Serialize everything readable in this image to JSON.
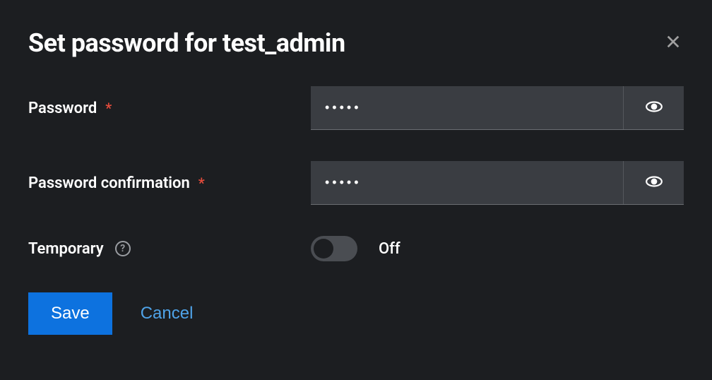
{
  "modal": {
    "title": "Set password for test_admin"
  },
  "form": {
    "password": {
      "label": "Password",
      "value": "•••••"
    },
    "password_confirmation": {
      "label": "Password confirmation",
      "value": "•••••"
    },
    "temporary": {
      "label": "Temporary",
      "state_label": "Off"
    }
  },
  "footer": {
    "save_label": "Save",
    "cancel_label": "Cancel"
  }
}
